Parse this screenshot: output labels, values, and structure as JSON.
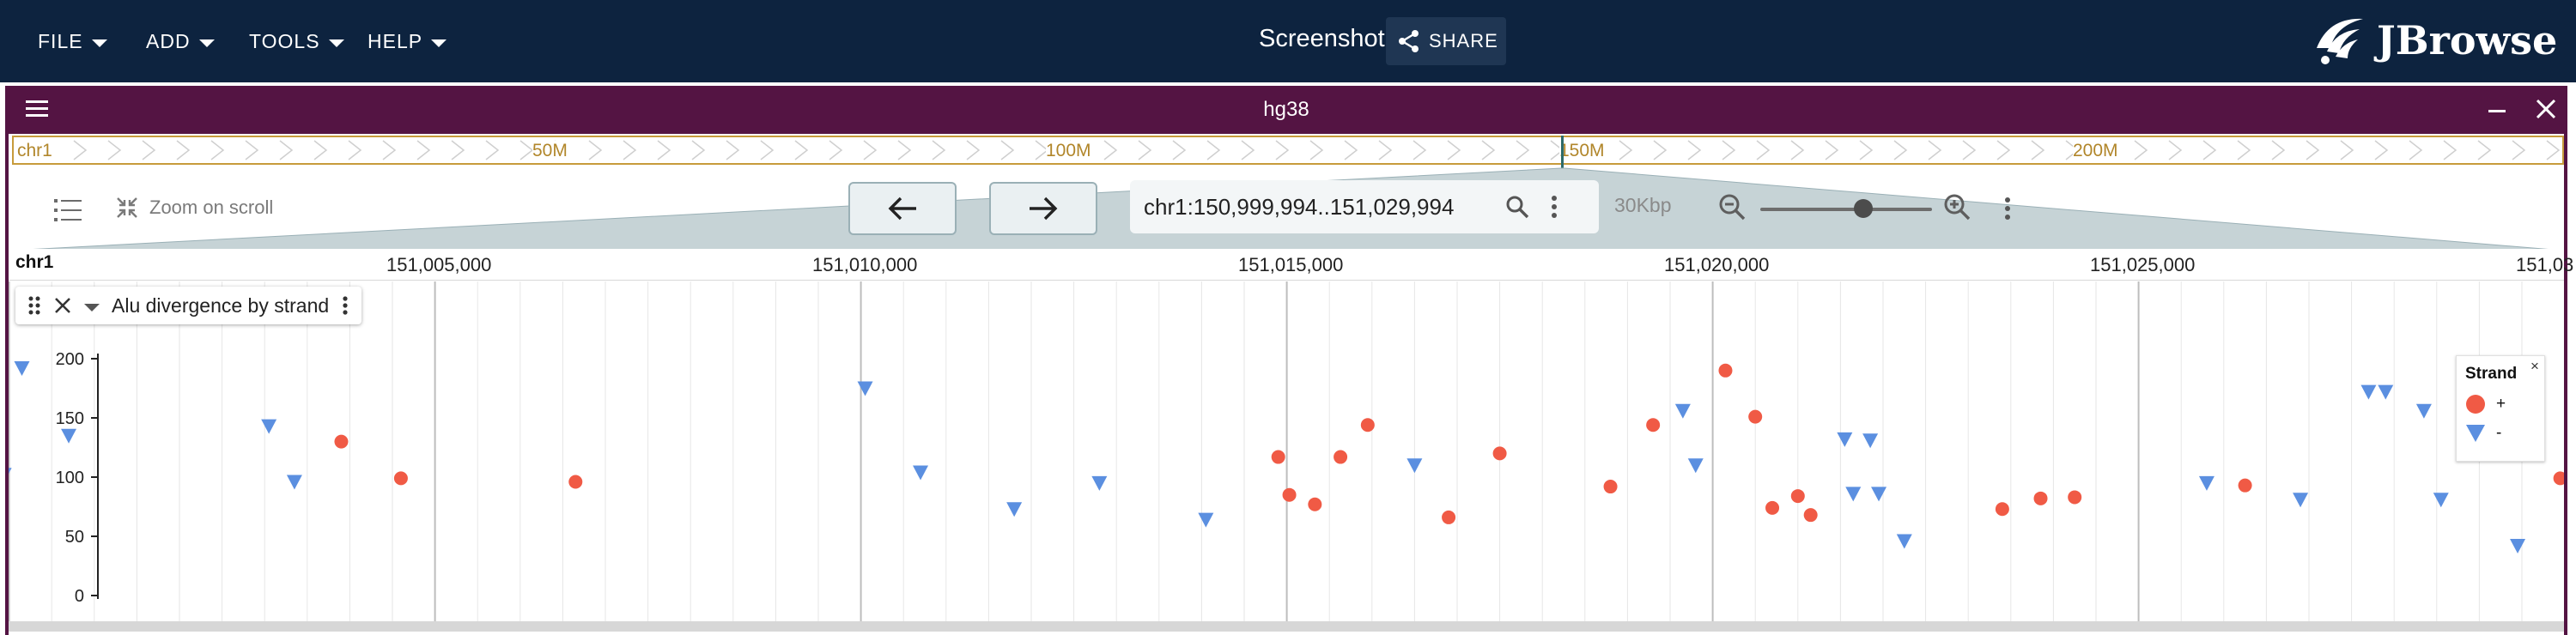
{
  "app": {
    "menus": [
      "FILE",
      "ADD",
      "TOOLS",
      "HELP"
    ],
    "session_name": "Screenshot",
    "share_label": "SHARE",
    "logo_text": "JBrowse"
  },
  "view": {
    "title": "hg38",
    "overview": {
      "chromosome": "chr1",
      "labels": [
        "50M",
        "100M",
        "150M",
        "200M"
      ]
    },
    "nav": {
      "zoom_on_scroll_label": "Zoom on scroll",
      "location": "chr1:150,999,994..151,029,994",
      "bp_per_view": "30Kbp",
      "zoom_level": 0.6
    },
    "ruler": {
      "chromosome": "chr1",
      "labels": [
        "151,005,000",
        "151,010,000",
        "151,015,000",
        "151,020,000",
        "151,025,000",
        "151,03"
      ]
    }
  },
  "track": {
    "name": "Alu divergence by strand",
    "y_ticks": [
      "200",
      "150",
      "100",
      "50",
      "0"
    ],
    "legend": {
      "title": "Strand",
      "items": [
        {
          "label": "+",
          "shape": "circle",
          "color": "#f05a45"
        },
        {
          "label": "-",
          "shape": "triangle-down",
          "color": "#5b8fe0"
        }
      ]
    }
  },
  "chart_data": {
    "type": "scatter",
    "x_range": [
      150999994,
      151029994
    ],
    "ylim": [
      0,
      210
    ],
    "series": [
      {
        "name": "+",
        "color": "#f05a45",
        "marker": "circle",
        "points": [
          {
            "x": 151003900,
            "y": 130
          },
          {
            "x": 151004600,
            "y": 99
          },
          {
            "x": 151006650,
            "y": 96
          },
          {
            "x": 151014900,
            "y": 117
          },
          {
            "x": 151015030,
            "y": 85
          },
          {
            "x": 151015330,
            "y": 77
          },
          {
            "x": 151015630,
            "y": 117
          },
          {
            "x": 151015950,
            "y": 144
          },
          {
            "x": 151016900,
            "y": 66
          },
          {
            "x": 151017500,
            "y": 120
          },
          {
            "x": 151018800,
            "y": 92
          },
          {
            "x": 151019300,
            "y": 144
          },
          {
            "x": 151020150,
            "y": 190
          },
          {
            "x": 151020500,
            "y": 151
          },
          {
            "x": 151020700,
            "y": 74
          },
          {
            "x": 151021000,
            "y": 84
          },
          {
            "x": 151021150,
            "y": 68
          },
          {
            "x": 151023400,
            "y": 73
          },
          {
            "x": 151023850,
            "y": 82
          },
          {
            "x": 151024250,
            "y": 83
          },
          {
            "x": 151026250,
            "y": 93
          },
          {
            "x": 151029950,
            "y": 99
          }
        ]
      },
      {
        "name": "-",
        "color": "#5b8fe0",
        "marker": "triangle-down",
        "points": [
          {
            "x": 151000150,
            "y": 192
          },
          {
            "x": 150999940,
            "y": 102
          },
          {
            "x": 151000700,
            "y": 135
          },
          {
            "x": 151003050,
            "y": 143
          },
          {
            "x": 151003350,
            "y": 96
          },
          {
            "x": 151010050,
            "y": 175
          },
          {
            "x": 151010700,
            "y": 104
          },
          {
            "x": 151011800,
            "y": 73
          },
          {
            "x": 151012800,
            "y": 95
          },
          {
            "x": 151014050,
            "y": 64
          },
          {
            "x": 151016500,
            "y": 110
          },
          {
            "x": 151019650,
            "y": 156
          },
          {
            "x": 151019800,
            "y": 110
          },
          {
            "x": 151021550,
            "y": 132
          },
          {
            "x": 151021650,
            "y": 86
          },
          {
            "x": 151021850,
            "y": 131
          },
          {
            "x": 151021950,
            "y": 86
          },
          {
            "x": 151022250,
            "y": 46
          },
          {
            "x": 151025800,
            "y": 95
          },
          {
            "x": 151026900,
            "y": 81
          },
          {
            "x": 151027700,
            "y": 172
          },
          {
            "x": 151027900,
            "y": 172
          },
          {
            "x": 151028350,
            "y": 156
          },
          {
            "x": 151028550,
            "y": 81
          },
          {
            "x": 151029450,
            "y": 42
          }
        ]
      }
    ]
  }
}
